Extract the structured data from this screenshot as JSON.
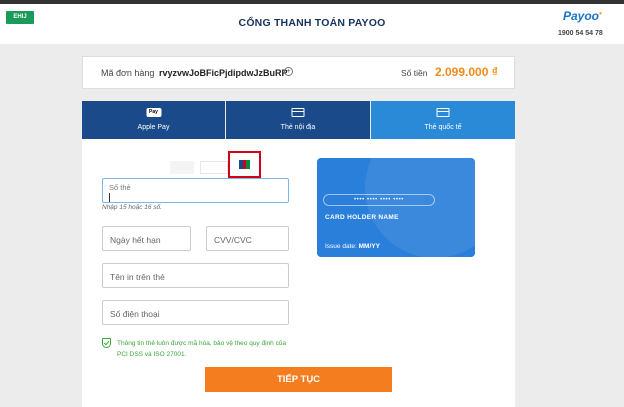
{
  "header": {
    "logo_text": "EHIJ",
    "title": "CỔNG THANH TOÁN PAYOO",
    "payoo_logo": "Payoo",
    "hotline": "1900 54 54 78"
  },
  "order": {
    "label": "Mã đơn hàng",
    "code": "rvyzvwJoBFicPjdipdwJzBuRP",
    "expand_icon": "+",
    "amount_label": "Số tiền",
    "amount": "2.099.000 ₫"
  },
  "tabs": [
    {
      "label": "Apple Pay",
      "icon": "apple-pay-icon",
      "icon_text": "Pay"
    },
    {
      "label": "Thẻ nội địa",
      "icon": "card-icon"
    },
    {
      "label": "Thẻ quốc tế",
      "icon": "card-icon",
      "active": true
    }
  ],
  "brands": {
    "jcb_colors": [
      "#0e4c96",
      "#d0021b",
      "#0a8a3c"
    ]
  },
  "form": {
    "card_number_label": "Số thẻ",
    "card_number_hint": "Nhập 15 hoặc 16 số.",
    "expiry_placeholder": "Ngày hết hạn",
    "cvv_placeholder": "CVV/CVC",
    "name_placeholder": "Tên in trên thẻ",
    "phone_placeholder": "Số điện thoại",
    "security_note": "Thông tin thẻ luôn được mã hóa, bảo vệ theo quy định của PCI DSS và ISO 27001.",
    "submit_label": "TIẾP TỤC"
  },
  "card_preview": {
    "number_mask": "•••• •••• •••• ••••",
    "holder": "CARD HOLDER NAME",
    "issue_label": "Issue date:",
    "issue_value": "MM/YY"
  },
  "colors": {
    "tab_inactive": "#1a4a8a",
    "tab_active": "#2a8ad8",
    "amount": "#f28b1a",
    "button": "#f47e1f",
    "secure": "#3aa63a",
    "highlight": "#d0021b"
  }
}
